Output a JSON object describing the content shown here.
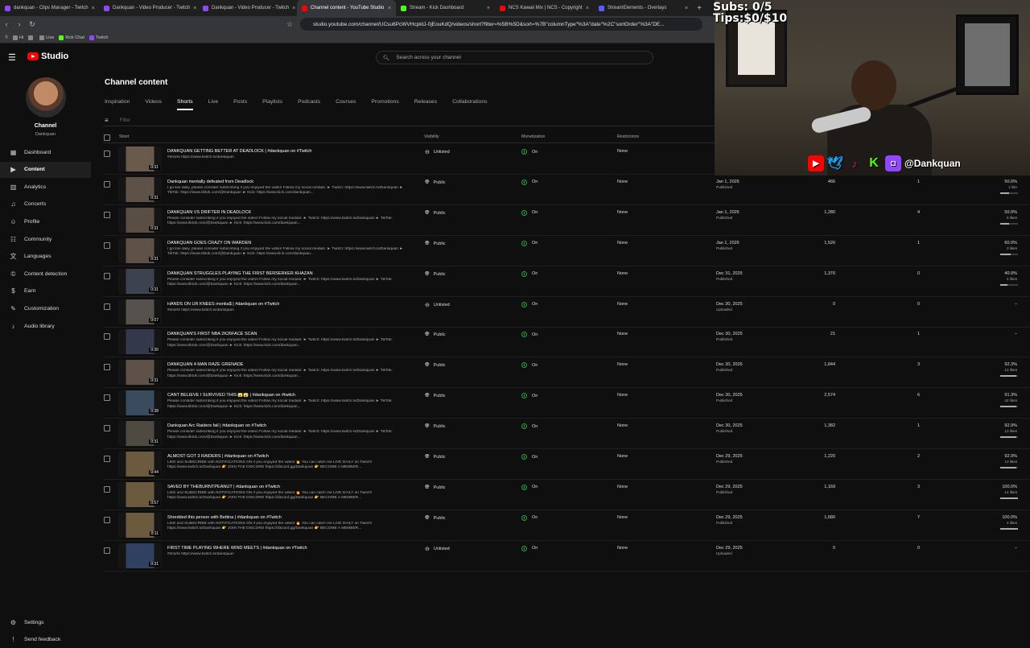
{
  "browser": {
    "tabs": [
      {
        "label": "dankquan - Clips Manager - Twitch",
        "color": "#9146ff",
        "active": false
      },
      {
        "label": "Dankquan - Video Producer - Twitch",
        "color": "#9146ff",
        "active": false
      },
      {
        "label": "Dankquan - Video Producer - Twitch",
        "color": "#9146ff",
        "active": false
      },
      {
        "label": "Channel content - YouTube Studio",
        "color": "#ff0000",
        "active": true
      },
      {
        "label": "Stream - Kick Dashboard",
        "color": "#53fc18",
        "active": false
      },
      {
        "label": "NCS Kawaii Mix | NCS - Copyright",
        "color": "#ff0000",
        "active": false
      },
      {
        "label": "StreamElements - Overlays",
        "color": "#5b5bff",
        "active": false
      }
    ],
    "url": "studio.youtube.com/channel/UCsu6PcWVHcpktJ-0jEouKdQ/videos/short?filter=%5B%5D&sort=%7B\"columnType\"%3A\"date\"%2C\"sortOrder\"%3A\"DE...",
    "bookmarks": [
      {
        "label": "Hi",
        "color": "#888"
      },
      {
        "label": "",
        "color": "#888"
      },
      {
        "label": "Live",
        "color": "#888"
      },
      {
        "label": "Kick Chat",
        "color": "#53fc18"
      },
      {
        "label": "Twitch",
        "color": "#9146ff"
      }
    ]
  },
  "header": {
    "logo_text": "Studio",
    "search_placeholder": "Search across your channel"
  },
  "sidebar": {
    "channel_label": "Channel",
    "channel_name": "Dankquan",
    "items": [
      {
        "label": "Dashboard",
        "icon": "dashboard-icon",
        "glyph": "▦",
        "active": false
      },
      {
        "label": "Content",
        "icon": "content-icon",
        "glyph": "▶",
        "active": true
      },
      {
        "label": "Analytics",
        "icon": "analytics-icon",
        "glyph": "▥",
        "active": false
      },
      {
        "label": "Concerts",
        "icon": "concerts-icon",
        "glyph": "♫",
        "active": false
      },
      {
        "label": "Profile",
        "icon": "profile-icon",
        "glyph": "☺",
        "active": false
      },
      {
        "label": "Community",
        "icon": "community-icon",
        "glyph": "☷",
        "active": false
      },
      {
        "label": "Languages",
        "icon": "languages-icon",
        "glyph": "文",
        "active": false
      },
      {
        "label": "Content detection",
        "icon": "content-detection-icon",
        "glyph": "©",
        "active": false
      },
      {
        "label": "Earn",
        "icon": "earn-icon",
        "glyph": "$",
        "active": false
      },
      {
        "label": "Customization",
        "icon": "customization-icon",
        "glyph": "✎",
        "active": false
      },
      {
        "label": "Audio library",
        "icon": "audio-library-icon",
        "glyph": "♪",
        "active": false
      }
    ],
    "bottom": [
      {
        "label": "Settings",
        "icon": "settings-icon",
        "glyph": "⚙"
      },
      {
        "label": "Send feedback",
        "icon": "feedback-icon",
        "glyph": "!"
      }
    ]
  },
  "main": {
    "title": "Channel content",
    "tabs": [
      "Inspiration",
      "Videos",
      "Shorts",
      "Live",
      "Posts",
      "Playlists",
      "Podcasts",
      "Courses",
      "Promotions",
      "Releases",
      "Collaborations"
    ],
    "active_tab": "Shorts",
    "filter_placeholder": "Filter",
    "columns": {
      "short": "Short",
      "visibility": "Visibility",
      "monetization": "Monetization",
      "restrictions": "Restrictions"
    }
  },
  "rows": [
    {
      "title": "DANKQUAN GETTING BETTER AT DEADLOCK | #dankquan on #Twitch",
      "desc": "#shorts https://www.twitch.tv/dankquan",
      "dur": "0:31",
      "visibility": "Unlisted",
      "monetization": "On",
      "restrictions": "None",
      "date": "",
      "status": "",
      "views": "",
      "comments": "",
      "likes_pct": "",
      "likes_count": "",
      "likes_fill": 0,
      "thumb": "#6a5a4c"
    },
    {
      "title": "Dankquan mentally defeated from Deadlock",
      "desc": "I go live daily, please consider subscribing if you enjoyed the video! Follow my social medias: ► Twitch: https://www.twitch.tv/Dankquan ► TikTok: https://www.tiktok.com/@Dankquan ► Kick: https://www.kick.com/dankquan...",
      "dur": "0:31",
      "visibility": "Public",
      "monetization": "On",
      "restrictions": "None",
      "date": "Jan 1, 2026",
      "status": "Published",
      "views": "466",
      "comments": "1",
      "likes_pct": "50.0%",
      "likes_count": "1 like",
      "likes_fill": 0.5,
      "thumb": "#5e5248"
    },
    {
      "title": "DANKQUAN VS DRIFTER IN DEADLOCK",
      "desc": "Please consider subscribing if you enjoyed the video! Follow my social medias: ► Twitch: https://www.twitch.tv/Dankquan ► TikTok: https://www.tiktok.com/@Dankquan ► Kick: https://www.kick.com/dankquan...",
      "dur": "0:31",
      "visibility": "Public",
      "monetization": "On",
      "restrictions": "None",
      "date": "Jan 1, 2026",
      "status": "Published",
      "views": "1,280",
      "comments": "4",
      "likes_pct": "50.0%",
      "likes_count": "5 likes",
      "likes_fill": 0.5,
      "thumb": "#5a4e44"
    },
    {
      "title": "DANKQUAN GOES CRAZY ON WARDEN",
      "desc": "I go live daily, please consider subscribing if you enjoyed the video! Follow my social medias: ► Twitch: https://www.twitch.tv/Dankquan ► TikTok: https://www.tiktok.com/@Dankquan ► Kick: https://www.kick.com/dankquan...",
      "dur": "0:31",
      "visibility": "Public",
      "monetization": "On",
      "restrictions": "None",
      "date": "Jan 1, 2026",
      "status": "Published",
      "views": "1,526",
      "comments": "1",
      "likes_pct": "60.0%",
      "likes_count": "3 likes",
      "likes_fill": 0.6,
      "thumb": "#5e5248"
    },
    {
      "title": "DANKQUAN STRUGGLES PLAYING THE FIRST BERSERKER KHAZAN",
      "desc": "Please consider subscribing if you enjoyed the video! Follow my social medias: ► Twitch: https://www.twitch.tv/Dankquan ► TikTok: https://www.tiktok.com/@Dankquan ► Kick: https://www.kick.com/dankquan...",
      "dur": "0:31",
      "visibility": "Public",
      "monetization": "On",
      "restrictions": "None",
      "date": "Dec 31, 2025",
      "status": "Published",
      "views": "1,376",
      "comments": "0",
      "likes_pct": "40.0%",
      "likes_count": "4 likes",
      "likes_fill": 0.4,
      "thumb": "#3d4250"
    },
    {
      "title": "HANDS ON UR KNEES monka$ | #dankquan on #Twitch",
      "desc": "#shorts https://www.twitch.tv/dankquan",
      "dur": "0:07",
      "visibility": "Unlisted",
      "monetization": "On",
      "restrictions": "None",
      "date": "Dec 30, 2025",
      "status": "Uploaded",
      "views": "0",
      "comments": "0",
      "likes_pct": "–",
      "likes_count": "",
      "likes_fill": 0,
      "thumb": "#55524e"
    },
    {
      "title": "DANKQUAN'S FIRST NBA 2K26FACE SCAN",
      "desc": "Please consider subscribing if you enjoyed the video! Follow my social medias: ► Twitch: https://www.twitch.tv/Dankquan ► TikTok: https://www.tiktok.com/@Dankquan ► Kick: https://www.kick.com/dankquan...",
      "dur": "0:30",
      "visibility": "Public",
      "monetization": "On",
      "restrictions": "None",
      "date": "Dec 30, 2025",
      "status": "Published",
      "views": "21",
      "comments": "1",
      "likes_pct": "–",
      "likes_count": "",
      "likes_fill": 0,
      "thumb": "#33394a"
    },
    {
      "title": "DANKQUAN 4 MAN RAZE GRENADE",
      "desc": "Please consider subscribing if you enjoyed the video! Follow my social medias: ► Twitch: https://www.twitch.tv/Dankquan ► TikTok: https://www.tiktok.com/@Dankquan ► Kick: https://www.kick.com/dankquan...",
      "dur": "0:31",
      "visibility": "Public",
      "monetization": "On",
      "restrictions": "None",
      "date": "Dec 30, 2025",
      "status": "Published",
      "views": "1,844",
      "comments": "3",
      "likes_pct": "92.3%",
      "likes_count": "12 likes",
      "likes_fill": 0.923,
      "thumb": "#5e5248"
    },
    {
      "title": "CANT BELIEVE I SURVIVED THIS 😱😱 | #dankquan on #twitch",
      "desc": "Please consider subscribing if you enjoyed the video! Follow my social medias: ► Twitch: https://www.twitch.tv/Dankquan ► TikTok: https://www.tiktok.com/@Dankquan ► Kick: https://www.kick.com/dankquan...",
      "dur": "0:38",
      "visibility": "Public",
      "monetization": "On",
      "restrictions": "None",
      "date": "Dec 30, 2025",
      "status": "Published",
      "views": "2,574",
      "comments": "6",
      "likes_pct": "91.3%",
      "likes_count": "42 likes",
      "likes_fill": 0.913,
      "thumb": "#3a4b5e"
    },
    {
      "title": "Dankquan Arc Raiders fail | #dankquan on #Twitch",
      "desc": "Please consider subscribing if you enjoyed the video! Follow my social medias: ► Twitch: https://www.twitch.tv/Dankquan ► TikTok: https://www.tiktok.com/@Dankquan ► Kick: https://www.kick.com/dankquan...",
      "dur": "0:31",
      "visibility": "Public",
      "monetization": "On",
      "restrictions": "None",
      "date": "Dec 30, 2025",
      "status": "Published",
      "views": "1,382",
      "comments": "1",
      "likes_pct": "92.9%",
      "likes_count": "13 likes",
      "likes_fill": 0.929,
      "thumb": "#4e4a42"
    },
    {
      "title": "ALMOST GOT 3 RAIDERS | #dankquan on #Twitch",
      "desc": "LIKE and SUBSCRIBE with NOTIFICATIONS ON if you enjoyed the video! 🔥 You can catch me LIVE DAILY on Twitch! https://www.twitch.tv/Dankquan 👉 JOIN THE DISCORD https://discord.gg/Dankquan 👉 BECOME A MEMBER...",
      "dur": "0:44",
      "visibility": "Public",
      "monetization": "On",
      "restrictions": "None",
      "date": "Dec 29, 2025",
      "status": "Published",
      "views": "1,220",
      "comments": "2",
      "likes_pct": "92.9%",
      "likes_count": "13 likes",
      "likes_fill": 0.929,
      "thumb": "#6b5a3e"
    },
    {
      "title": "SAVED BY THEBURNTPEANUT | #dankquan on #Twitch",
      "desc": "LIKE and SUBSCRIBE with NOTIFICATIONS ON if you enjoyed the video! 🔥 You can catch me LIVE DAILY on Twitch! https://www.twitch.tv/Dankquan 👉 JOIN THE DISCORD https://discord.gg/Dankquan 👉 BECOME A MEMBER...",
      "dur": "0:57",
      "visibility": "Public",
      "monetization": "On",
      "restrictions": "None",
      "date": "Dec 29, 2025",
      "status": "Published",
      "views": "1,169",
      "comments": "3",
      "likes_pct": "100.0%",
      "likes_count": "14 likes",
      "likes_fill": 1.0,
      "thumb": "#6b5a3e"
    },
    {
      "title": "Shredded this person with Bettina | #dankquan on #Twitch",
      "desc": "LIKE and SUBSCRIBE with NOTIFICATIONS ON if you enjoyed the video! 🔥 You can catch me LIVE DAILY on Twitch! https://www.twitch.tv/Dankquan 👉 JOIN THE DISCORD https://discord.gg/Dankquan 👉 BECOME A MEMBER...",
      "dur": "0:11",
      "visibility": "Public",
      "monetization": "On",
      "restrictions": "None",
      "date": "Dec 29, 2025",
      "status": "Published",
      "views": "1,680",
      "comments": "7",
      "likes_pct": "100.0%",
      "likes_count": "4 likes",
      "likes_fill": 1.0,
      "thumb": "#6b5a3e"
    },
    {
      "title": "FIRST TIME PLAYING WHERE WIND MEETS | #dankquan on #Twitch",
      "desc": "#shorts https://www.twitch.tv/dankquan",
      "dur": "0:31",
      "visibility": "Unlisted",
      "monetization": "On",
      "restrictions": "None",
      "date": "Dec 29, 2025",
      "status": "Uploaded",
      "views": "0",
      "comments": "0",
      "likes_pct": "–",
      "likes_count": "",
      "likes_fill": 0,
      "thumb": "#2f4060"
    }
  ],
  "overlay": {
    "subs": "Subs: 0/5",
    "tips": "Tips:$0/$10",
    "handle": "@Dankquan",
    "icons": [
      "youtube-icon",
      "twitter-icon",
      "tiktok-icon",
      "kick-icon",
      "twitch-icon"
    ]
  }
}
